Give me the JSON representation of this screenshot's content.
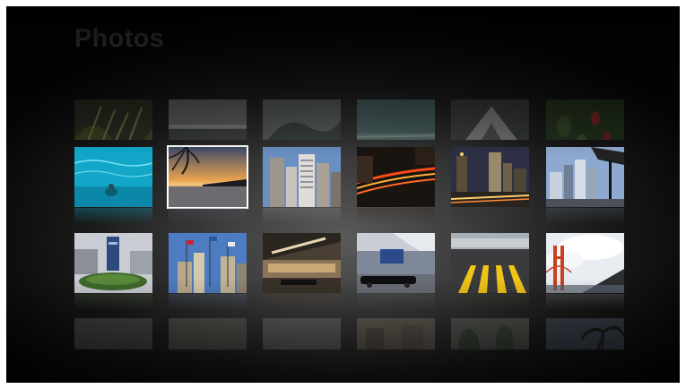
{
  "app": {
    "title": "Photos"
  },
  "photos": {
    "rows": [
      {
        "row": "top-faded",
        "tiles": [
          "palm-fronds",
          "gray-sea",
          "green-hill",
          "teal-water",
          "white-sculpture",
          "red-flowers"
        ]
      },
      {
        "row": "row-1",
        "tiles": [
          "swimming-pool",
          "tropical-sunset",
          "city-buildings",
          "night-light-trails",
          "night-skyline",
          "glass-towers"
        ]
      },
      {
        "row": "row-2",
        "tiles": [
          "plaza-sign",
          "flags-buildings",
          "convention-center",
          "limousine-building",
          "crosswalk-lines",
          "golden-gate-bridge"
        ]
      },
      {
        "row": "bottom-faded",
        "tiles": [
          "city-view",
          "hazy-sky",
          "overcast-sky",
          "building-interior",
          "street-trees",
          "palm-tree"
        ]
      }
    ],
    "selected": "tropical-sunset"
  }
}
